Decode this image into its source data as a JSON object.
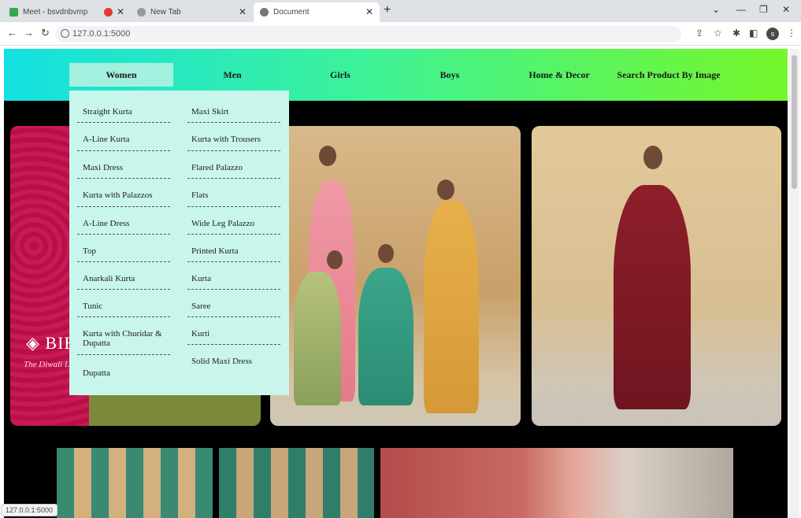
{
  "browser": {
    "tabs": [
      {
        "title": "Meet - bsvdnbvmp",
        "active": false
      },
      {
        "title": "",
        "active": false
      },
      {
        "title": "New Tab",
        "active": false
      },
      {
        "title": "Document",
        "active": true
      }
    ],
    "url": "127.0.0.1:5000",
    "status_text": "127.0.0.1:5000"
  },
  "nav": {
    "items": [
      "Women",
      "Men",
      "Girls",
      "Boys",
      "Home & Decor",
      "Search Product By Image"
    ],
    "active": "Women"
  },
  "dropdown": {
    "left": [
      "Straight Kurta",
      "A-Line Kurta",
      "Maxi Dress",
      "Kurta with Palazzos",
      "A-Line Dress",
      "Top",
      "Anarkali Kurta",
      "Tunic",
      "Kurta with Churidar & Dupatta",
      "Dupatta"
    ],
    "right": [
      "Maxi Skirt",
      "Kurta with Trousers",
      "Flared Palazzo",
      "Flats",
      "Wide Leg Palazzo",
      "Printed Kurta",
      "Kurta",
      "Saree",
      "Kurti",
      "Solid Maxi Dress"
    ]
  },
  "banner": {
    "logo": "BIBA",
    "tagline": "The Diwali L"
  },
  "colors": {
    "navbar_start": "#14e0e3",
    "navbar_end": "#76f62a",
    "dropdown_bg": "#c8f6ec",
    "page_bg": "#000000"
  }
}
